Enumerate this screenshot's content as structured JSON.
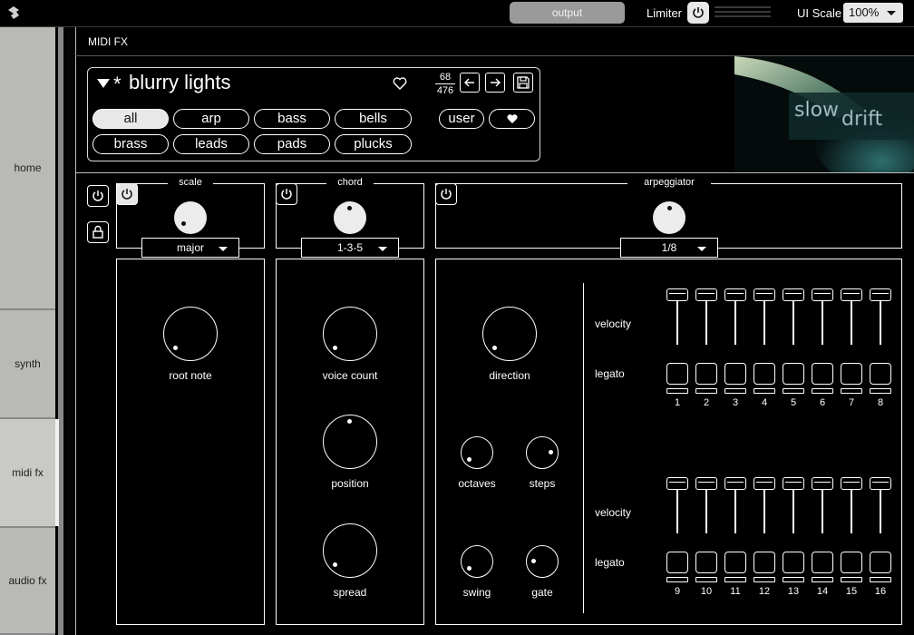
{
  "topbar": {
    "output_label": "output",
    "limiter_label": "Limiter",
    "ui_scale_label": "UI Scale",
    "ui_scale_value": "100%"
  },
  "sidebar": {
    "items": [
      {
        "label": "home"
      },
      {
        "label": "synth"
      },
      {
        "label": "midi fx",
        "active": true
      },
      {
        "label": "audio fx"
      }
    ]
  },
  "section_title": "MIDI FX",
  "preset": {
    "name": "blurry lights",
    "modified_marker": "*",
    "index": "68",
    "total": "476",
    "filters": [
      "all",
      "arp",
      "bass",
      "bells",
      "brass",
      "leads",
      "pads",
      "plucks"
    ],
    "active_filter": "all",
    "user_filter": "user"
  },
  "scale": {
    "header": "scale",
    "dropdown_value": "major",
    "knob_label": "root note"
  },
  "chord": {
    "header": "chord",
    "dropdown_value": "1-3-5",
    "knob_labels": [
      "voice count",
      "position",
      "spread"
    ]
  },
  "arpeggiator": {
    "header": "arpeggiator",
    "dropdown_value": "1/8",
    "knob_labels": [
      "direction",
      "octaves",
      "steps",
      "swing",
      "gate"
    ],
    "row_labels": {
      "velocity": "velocity",
      "legato": "legato"
    },
    "steps_top": [
      "1",
      "2",
      "3",
      "4",
      "5",
      "6",
      "7",
      "8"
    ],
    "steps_bottom": [
      "9",
      "10",
      "11",
      "12",
      "13",
      "14",
      "15",
      "16"
    ]
  },
  "colors": {
    "background": "#000000",
    "panel_tab": "#b9b9b6",
    "accent": "#e8e8e8",
    "output_button": "#9a9a9a"
  }
}
